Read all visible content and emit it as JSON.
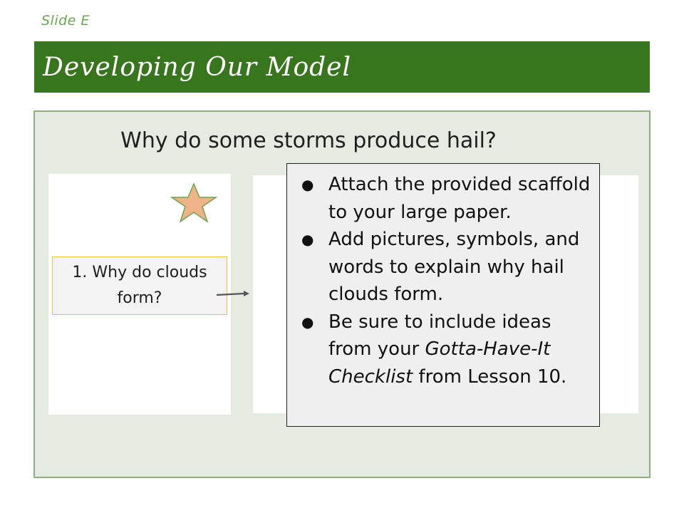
{
  "slide": {
    "label": "Slide E",
    "title": "Developing Our Model"
  },
  "question": "Why do some storms produce hail?",
  "step1": {
    "text": "1. Why do clouds form?"
  },
  "instructions": {
    "item1": "Attach the provided scaffold to your large paper.",
    "item2": "Add pictures, symbols, and words to explain why hail clouds form.",
    "item3_before": "Be sure to include ideas from your ",
    "item3_italic": "Gotta-Have-It Checklist",
    "item3_after": " from Lesson 10."
  },
  "colors": {
    "title_bar": "#38761d",
    "panel_bg": "#e6ebe1",
    "star_fill": "#f0b287",
    "star_stroke": "#6aa84f",
    "step_border": "#f1c232"
  },
  "icons": {
    "star": "star-icon",
    "arrow": "arrow-right-icon",
    "bullet": "bullet-icon"
  }
}
